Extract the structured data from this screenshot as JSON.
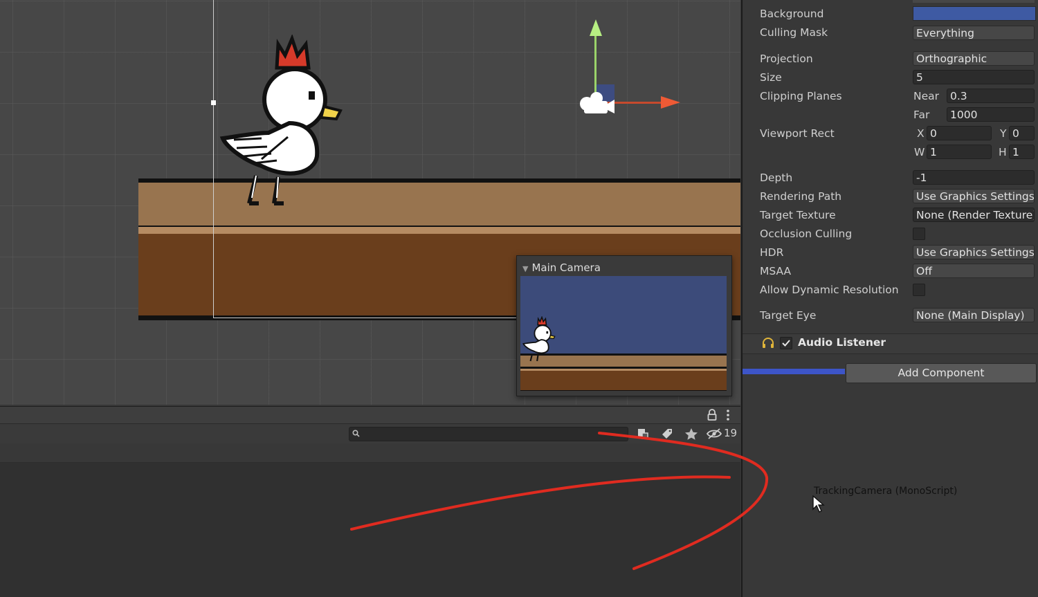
{
  "scene": {
    "camera_preview_title": "Main Camera"
  },
  "hierarchy": {
    "search_placeholder": "",
    "hidden_count": "19",
    "icons": [
      "lock-icon",
      "kebab-menu-icon",
      "search-icon",
      "scene-visibility-icon",
      "tag-icon",
      "star-icon",
      "eye-slash-icon"
    ]
  },
  "inspector": {
    "camera": {
      "background_label": "Background",
      "background_color": "#3e5aa3",
      "culling_mask_label": "Culling Mask",
      "culling_mask_value": "Everything",
      "projection_label": "Projection",
      "projection_value": "Orthographic",
      "size_label": "Size",
      "size_value": "5",
      "clipping_label": "Clipping Planes",
      "near_label": "Near",
      "near_value": "0.3",
      "far_label": "Far",
      "far_value": "1000",
      "viewport_label": "Viewport Rect",
      "x_label": "X",
      "x_value": "0",
      "y_label": "Y",
      "y_value": "0",
      "w_label": "W",
      "w_value": "1",
      "h_label": "H",
      "h_value": "1",
      "depth_label": "Depth",
      "depth_value": "-1",
      "rendering_path_label": "Rendering Path",
      "rendering_path_value": "Use Graphics Settings",
      "target_texture_label": "Target Texture",
      "target_texture_value": "None (Render Texture)",
      "occlusion_label": "Occlusion Culling",
      "hdr_label": "HDR",
      "hdr_value": "Use Graphics Settings",
      "msaa_label": "MSAA",
      "msaa_value": "Off",
      "dynamic_res_label": "Allow Dynamic Resolution",
      "target_eye_label": "Target Eye",
      "target_eye_value": "None (Main Display)"
    },
    "audio_listener_label": "Audio Listener",
    "add_component_label": "Add Component",
    "drag_label": "TrackingCamera (MonoScript)"
  },
  "colors": {
    "accent_blue": "#3d55c8",
    "annotation_red": "#e02b20",
    "gizmo_green": "#b7ef83",
    "gizmo_red": "#ee5a35"
  }
}
